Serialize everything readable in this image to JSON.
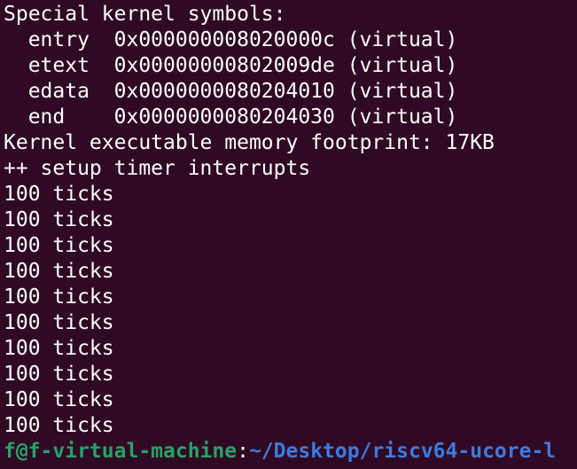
{
  "terminal": {
    "lines": [
      "Special kernel symbols:",
      "  entry  0x000000008020000c (virtual)",
      "  etext  0x00000000802009de (virtual)",
      "  edata  0x0000000080204010 (virtual)",
      "  end    0x0000000080204030 (virtual)",
      "Kernel executable memory footprint: 17KB",
      "++ setup timer interrupts",
      "100 ticks",
      "100 ticks",
      "100 ticks",
      "100 ticks",
      "100 ticks",
      "100 ticks",
      "100 ticks",
      "100 ticks",
      "100 ticks",
      "100 ticks"
    ],
    "prompt": {
      "user_host": "f@f-virtual-machine",
      "separator": ":",
      "path": "~/Desktop/riscv64-ucore-l"
    }
  },
  "colors": {
    "background": "#300a24",
    "text": "#ffffff",
    "prompt_user": "#26a269",
    "prompt_path": "#3d7be0"
  }
}
